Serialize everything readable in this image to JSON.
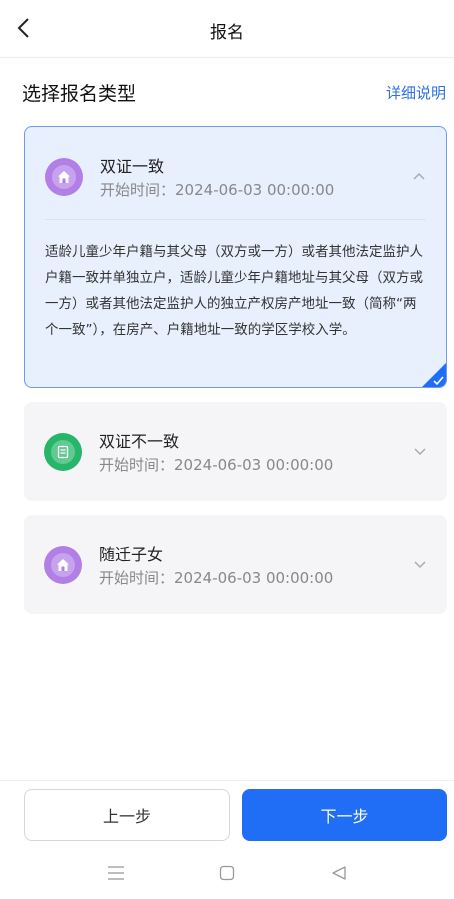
{
  "header": {
    "title": "报名"
  },
  "section": {
    "title": "选择报名类型",
    "detail_link": "详细说明"
  },
  "options": [
    {
      "name": "双证一致",
      "time_label": "开始时间：",
      "time_value": "2024-06-03 00:00:00",
      "icon": "home-badge-icon",
      "color": "#b27fe6",
      "expanded": true,
      "selected": true,
      "description": "适龄儿童少年户籍与其父母（双方或一方）或者其他法定监护人户籍一致并单独立户，适龄儿童少年户籍地址与其父母（双方或一方）或者其他法定监护人的独立产权房产地址一致（简称“两个一致”），在房产、户籍地址一致的学区学校入学。"
    },
    {
      "name": "双证不一致",
      "time_label": "开始时间：",
      "time_value": "2024-06-03 00:00:00",
      "icon": "document-badge-icon",
      "color": "#27b56a",
      "expanded": false,
      "selected": false
    },
    {
      "name": "随迁子女",
      "time_label": "开始时间：",
      "time_value": "2024-06-03 00:00:00",
      "icon": "home-badge-icon",
      "color": "#b27fe6",
      "expanded": false,
      "selected": false
    }
  ],
  "footer": {
    "prev_label": "上一步",
    "next_label": "下一步"
  },
  "colors": {
    "accent": "#1f6ef5",
    "link": "#2f6fe3"
  }
}
